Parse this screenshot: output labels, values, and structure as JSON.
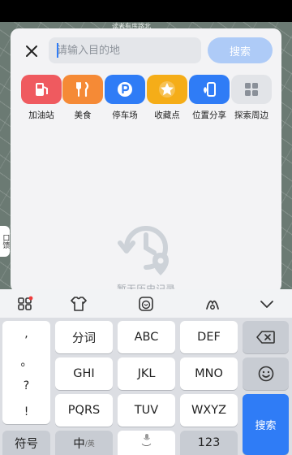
{
  "map": {
    "label": "读者有序路北"
  },
  "map_float": {
    "text": "口馈",
    "close": "✕"
  },
  "search": {
    "placeholder": "请输入目的地",
    "button": "搜索"
  },
  "quick_actions": [
    {
      "label": "加油站",
      "icon": "gas-station-icon",
      "color": "#ef5a5f"
    },
    {
      "label": "美食",
      "icon": "food-icon",
      "color": "#f58a36"
    },
    {
      "label": "停车场",
      "icon": "parking-icon",
      "color": "#2f7cf6"
    },
    {
      "label": "收藏点",
      "icon": "star-icon",
      "color": "#f5ad18"
    },
    {
      "label": "位置分享",
      "icon": "share-location-icon",
      "color": "#2f7cf6"
    },
    {
      "label": "探索周边",
      "icon": "grid-icon",
      "color": "#e2e4e8"
    }
  ],
  "history": {
    "empty_text": "暂无历史记录"
  },
  "keyboard": {
    "punct": [
      ",",
      "。",
      "?",
      "!"
    ],
    "row1": [
      "分词",
      "ABC",
      "DEF"
    ],
    "row2": [
      "GHI",
      "JKL",
      "MNO"
    ],
    "row3": [
      "PQRS",
      "TUV",
      "WXYZ"
    ],
    "symbols": "符号",
    "lang": "中",
    "lang_sub": "/英",
    "numbers": "123",
    "enter": "搜索",
    "space_mark": "︶"
  },
  "colors": {
    "accent": "#2f7cf6",
    "search_button": "#aecbf7"
  }
}
